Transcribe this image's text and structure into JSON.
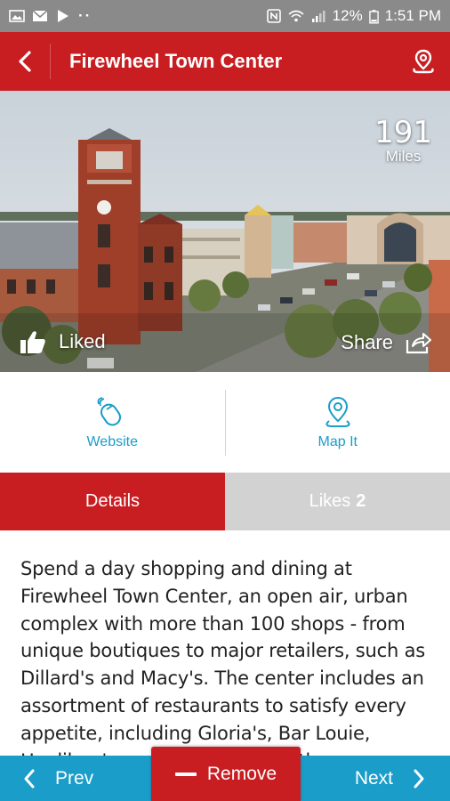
{
  "status_bar": {
    "battery": "12%",
    "time": "1:51 PM"
  },
  "header": {
    "title": "Firewheel Town Center"
  },
  "hero": {
    "distance_value": "191",
    "distance_unit": "Miles",
    "liked_label": "Liked",
    "share_label": "Share"
  },
  "actions": {
    "website_label": "Website",
    "mapit_label": "Map It"
  },
  "tabs": {
    "details_label": "Details",
    "likes_label": "Likes",
    "likes_count": "2"
  },
  "description": "Spend a day shopping and dining at Firewheel Town Center, an open air, urban complex with more than 100 shops - from unique boutiques to major retailers, such as Dillard's and Macy's. The center includes an assortment of restaurants to satisfy every appetite, including Gloria's, Bar Louie, Houlihan's and more, along with an",
  "bottom_bar": {
    "prev_label": "Prev",
    "remove_label": "Remove",
    "next_label": "Next"
  },
  "colors": {
    "brand_red": "#c81e22",
    "accent_blue": "#1a9dc9",
    "tab_inactive": "#d2d2d2"
  }
}
